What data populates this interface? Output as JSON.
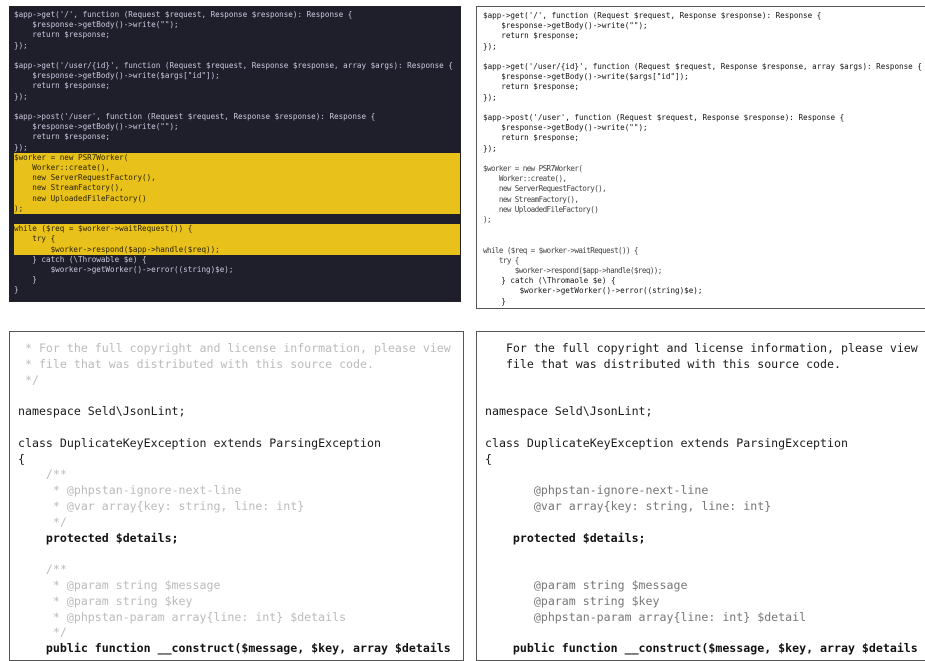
{
  "panels": {
    "top_left": {
      "lines": [
        "$app->get('/', function (Request $request, Response $response): Response {",
        "    $response->getBody()->write(\"\");",
        "    return $response;",
        "});",
        "",
        "$app->get('/user/{id}', function (Request $request, Response $response, array $args): Response {",
        "    $response->getBody()->write($args[\"id\"]);",
        "    return $response;",
        "});",
        "",
        "$app->post('/user', function (Request $request, Response $response): Response {",
        "    $response->getBody()->write(\"\");",
        "    return $response;",
        "});",
        "$worker = new PSR7Worker(",
        "    Worker::create(),",
        "    new ServerRequestFactory(),",
        "    new StreamFactory(),",
        "    new UploadedFileFactory()",
        ");",
        "",
        "while ($req = $worker->waitRequest()) {",
        "    try {",
        "        $worker->respond($app->handle($req));",
        "    } catch (\\Throwable $e) {",
        "        $worker->getWorker()->error((string)$e);",
        "    }",
        "}"
      ]
    },
    "top_right": {
      "lines": [
        "$app->get('/', function (Request $request, Response $response): Response {",
        "    $response->getBody()->write(\"\");",
        "    return $response;",
        "});",
        "",
        "$app->get('/user/{id}', function (Request $request, Response $response, array $args): Response {",
        "    $response->getBody()->write($args[\"id\"]);",
        "    return $response;",
        "});",
        "",
        "$app->post('/user', function (Request $request, Response $response): Response {",
        "    $response->getBody()->write(\"\");",
        "    return $response;",
        "});",
        "",
        "$worker = new PSR7Worker(",
        "    Worker::create(),",
        "    new ServerRequestFactory(),",
        "    new StreamFactory(),",
        "    new UploadedFileFactory()",
        ");",
        "",
        "",
        "while ($req = $worker->waitRequest()) {",
        "    try {",
        "        $worker->respond($app->handle($req));",
        "    } catch (\\Thromaole $e) {",
        "        $worker->getWorker()->error((string)$e);",
        "    }",
        "}"
      ]
    },
    "bottom_left": {
      "lines": [
        " * For the full copyright and license information, please view",
        " * file that was distributed with this source code.",
        " */",
        "",
        "namespace Seld\\JsonLint;",
        "",
        "class DuplicateKeyException extends ParsingException",
        "{",
        "    /**",
        "     * @phpstan-ignore-next-line",
        "     * @var array{key: string, line: int}",
        "     */",
        "    protected $details;",
        "",
        "    /**",
        "     * @param string $message",
        "     * @param string $key",
        "     * @phpstan-param array{line: int} $details",
        "     */",
        "    public function __construct($message, $key, array $details"
      ]
    },
    "bottom_right": {
      "lines": [
        "   For the full copyright and license information, please view",
        "   file that was distributed with this source code.",
        "",
        "",
        "namespace Seld\\JsonLint;",
        "",
        "class DuplicateKeyException extends ParsingException",
        "{",
        "",
        "       @phpstan-ignore-next-line",
        "       @var array{key: string, line: int}",
        "",
        "    protected $details;",
        "",
        "",
        "       @param string $message",
        "       @param string $key",
        "       @phpstan-param array{line: int} $detail",
        "",
        "    public function __construct($message, $key, array $details"
      ]
    }
  },
  "colors": {
    "dark_bg": "#1f1e2b",
    "highlight": "#e8c21a",
    "keyword": "#c08af2",
    "variable": "#ef6d78",
    "string": "#e0d26b"
  }
}
